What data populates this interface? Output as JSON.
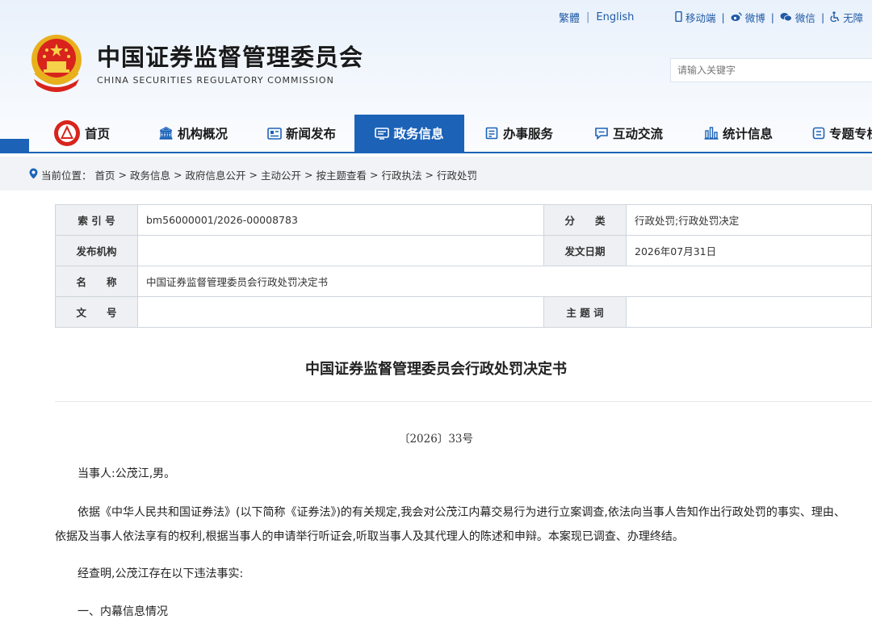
{
  "header": {
    "lang_links": [
      "繁體",
      "English"
    ],
    "utility_links": [
      {
        "icon": "mobile-icon",
        "label": "移动端"
      },
      {
        "icon": "weibo-icon",
        "label": "微博"
      },
      {
        "icon": "wechat-icon",
        "label": "微信"
      },
      {
        "icon": "accessibility-icon",
        "label": "无障"
      }
    ],
    "site_title": "中国证券监督管理委员会",
    "site_subtitle": "CHINA SECURITIES REGULATORY COMMISSION",
    "search_placeholder": "请输入关键字"
  },
  "nav": {
    "items": [
      {
        "icon": "home-emblem-icon",
        "label": "首页"
      },
      {
        "icon": "institution-icon",
        "label": "机构概况"
      },
      {
        "icon": "news-icon",
        "label": "新闻发布"
      },
      {
        "icon": "government-info-icon",
        "label": "政务信息",
        "active": true
      },
      {
        "icon": "service-icon",
        "label": "办事服务"
      },
      {
        "icon": "interaction-icon",
        "label": "互动交流"
      },
      {
        "icon": "statistics-icon",
        "label": "统计信息"
      },
      {
        "icon": "topic-icon",
        "label": "专题专栏"
      }
    ]
  },
  "breadcrumb": {
    "prefix": "当前位置：",
    "items": [
      "首页",
      "政务信息",
      "政府信息公开",
      "主动公开",
      "按主题查看",
      "行政执法",
      "行政处罚"
    ],
    "sep": ">"
  },
  "meta_table": {
    "index_label": "索 引 号",
    "index_value": "bm56000001/2026-00008783",
    "category_label": "分　　类",
    "category_value": "行政处罚;行政处罚决定",
    "publisher_label": "发布机构",
    "publisher_value": "",
    "date_label": "发文日期",
    "date_value": "2026年07月31日",
    "name_label": "名　　称",
    "name_value": "中国证券监督管理委员会行政处罚决定书",
    "doc_no_label": "文　　号",
    "doc_no_value": "",
    "keywords_label": "主 题 词",
    "keywords_value": ""
  },
  "document": {
    "title": "中国证券监督管理委员会行政处罚决定书",
    "number": "〔2026〕33号",
    "paragraphs": [
      "当事人:公茂江,男。",
      "依据《中华人民共和国证券法》(以下简称《证券法》)的有关规定,我会对公茂江内幕交易行为进行立案调查,依法向当事人告知作出行政处罚的事实、理由、依据及当事人依法享有的权利,根据当事人的申请举行听证会,听取当事人及其代理人的陈述和申辩。本案现已调查、办理终结。",
      "经查明,公茂江存在以下违法事实:",
      "一、内幕信息情况"
    ]
  }
}
